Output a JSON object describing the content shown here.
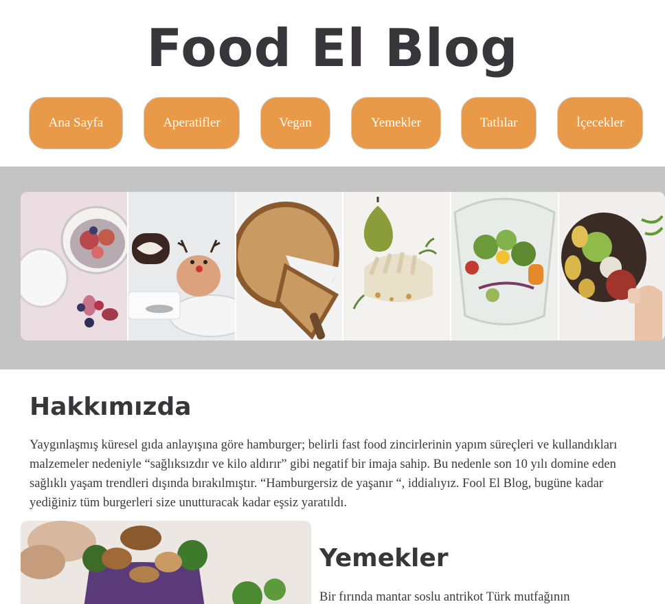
{
  "header": {
    "title": "Food El Blog"
  },
  "nav": {
    "items": [
      {
        "label": "Ana Sayfa"
      },
      {
        "label": "Aperatifler"
      },
      {
        "label": "Vegan"
      },
      {
        "label": "Yemekler"
      },
      {
        "label": "Tatlılar"
      },
      {
        "label": "İçecekler"
      }
    ]
  },
  "gallery": {
    "images": [
      {
        "name": "chia-pudding-figs-photo"
      },
      {
        "name": "reindeer-dessert-photo"
      },
      {
        "name": "pie-slice-photo"
      },
      {
        "name": "pear-plated-dish-photo"
      },
      {
        "name": "salad-glass-photo"
      },
      {
        "name": "guacamole-bowl-photo"
      }
    ]
  },
  "about": {
    "title": "Hakkımızda",
    "text": "Yaygınlaşmış küresel gıda anlayışına göre hamburger; belirli fast food zincirlerinin yapım süreçleri ve kullandıkları malzemeler nedeniyle “sağlıksızdır ve kilo aldırır” gibi negatif bir imaja sahip. Bu nedenle son 10 yılı domine eden sağlıklı yaşam trendleri dışında bırakılmıştır. “Hamburgersiz de yaşanır “, iddialıyız. Fool El Blog, bugüne kadar yediğiniz tüm burgerleri size unutturacak kadar eşsiz yaratıldı."
  },
  "dishes": {
    "title": "Yemekler",
    "text": "Bir fırında mantar soslu antrikot Türk mutfağının"
  },
  "colors": {
    "accent": "#e89a48",
    "band": "#c4c4c4",
    "heading": "#38363a"
  }
}
